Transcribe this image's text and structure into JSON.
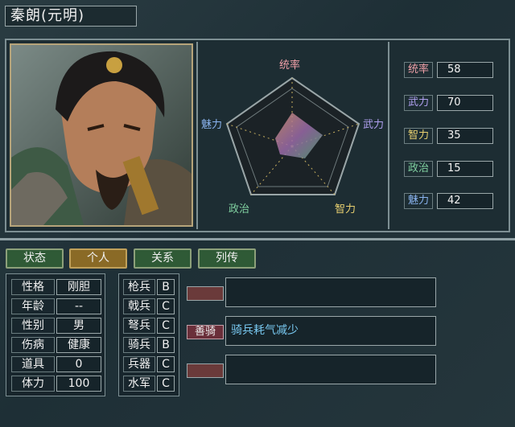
{
  "officer": {
    "name": "秦朗(元明)"
  },
  "colors": {
    "leadership": "#f0a0a8",
    "war": "#b0a0f0",
    "intelligence": "#e8d070",
    "politics": "#80d0a0",
    "charisma": "#8ab4f0"
  },
  "radar": {
    "labels": {
      "top": "统率",
      "right": "武力",
      "bottom_right": "智力",
      "bottom_left": "政治",
      "left": "魅力"
    }
  },
  "stats": [
    {
      "label": "统率",
      "value": "58"
    },
    {
      "label": "武力",
      "value": "70"
    },
    {
      "label": "智力",
      "value": "35"
    },
    {
      "label": "政治",
      "value": "15"
    },
    {
      "label": "魅力",
      "value": "42"
    }
  ],
  "tabs": [
    "状态",
    "个人",
    "关系",
    "列传"
  ],
  "personal": [
    {
      "label": "性格",
      "value": "刚胆"
    },
    {
      "label": "年龄",
      "value": "--"
    },
    {
      "label": "性别",
      "value": "男"
    },
    {
      "label": "伤病",
      "value": "健康"
    },
    {
      "label": "道具",
      "value": "0"
    },
    {
      "label": "体力",
      "value": "100"
    }
  ],
  "aptitude": [
    {
      "label": "枪兵",
      "grade": "B"
    },
    {
      "label": "戟兵",
      "grade": "C"
    },
    {
      "label": "弩兵",
      "grade": "C"
    },
    {
      "label": "骑兵",
      "grade": "B"
    },
    {
      "label": "兵器",
      "grade": "C"
    },
    {
      "label": "水军",
      "grade": "C"
    }
  ],
  "skills": [
    {
      "tag": "",
      "desc": ""
    },
    {
      "tag": "善骑",
      "desc": "骑兵耗气减少"
    },
    {
      "tag": "",
      "desc": ""
    }
  ]
}
